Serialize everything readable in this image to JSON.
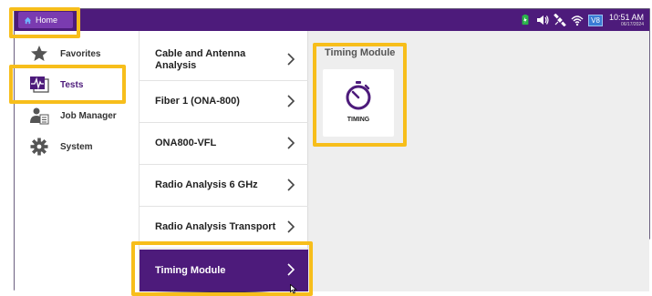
{
  "topbar": {
    "home_label": "Home",
    "badge": "V8",
    "time": "10:51 AM",
    "date": "06/17/2024",
    "icons": [
      "battery-icon",
      "speaker-icon",
      "satellite-icon",
      "wifi-icon"
    ]
  },
  "leftnav": {
    "items": [
      {
        "label": "Favorites",
        "icon": "star-icon"
      },
      {
        "label": "Tests",
        "icon": "tests-icon"
      },
      {
        "label": "Job Manager",
        "icon": "job-manager-icon"
      },
      {
        "label": "System",
        "icon": "gear-icon"
      }
    ],
    "active": "Tests"
  },
  "tests": {
    "items": [
      {
        "label": "Cable and Antenna Analysis"
      },
      {
        "label": "Fiber 1 (ONA-800)"
      },
      {
        "label": "ONA800-VFL"
      },
      {
        "label": "Radio Analysis 6 GHz"
      },
      {
        "label": "Radio Analysis Transport"
      },
      {
        "label": "Timing Module"
      }
    ],
    "selected": "Timing Module"
  },
  "content": {
    "title": "Timing Module",
    "tile": {
      "label": "TIMING",
      "icon": "stopwatch-icon"
    }
  },
  "colors": {
    "primary": "#4d1b7b",
    "highlight": "#f7be1b",
    "content_bg": "#eeeeee"
  }
}
